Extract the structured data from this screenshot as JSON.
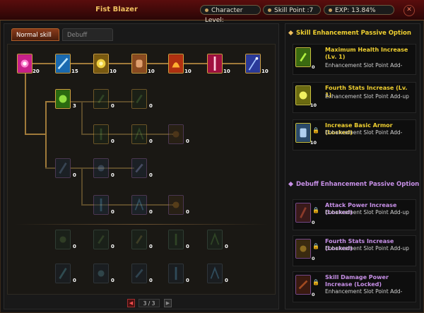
{
  "window": {
    "title": "Fist Blazer",
    "character_level_label": "Character Level:",
    "skill_point_label": "Skill Point :7",
    "exp_label": "EXP:  13.84%",
    "close_symbol": "✕"
  },
  "tabs": [
    {
      "label": "Normal skill enh",
      "active": true
    },
    {
      "label": "Debuff Explosio",
      "active": false
    }
  ],
  "tree": {
    "top_row_levels": [
      "20",
      "15",
      "10",
      "10",
      "10",
      "10",
      "10"
    ],
    "branch1_levels": [
      "3",
      "0",
      "0"
    ],
    "branch1b_levels": [
      "0",
      "0",
      "0"
    ],
    "branch2_levels": [
      "0",
      "0",
      "0"
    ],
    "branch2b_levels": [
      "0",
      "0",
      "0"
    ],
    "locked_row1_levels": [
      "0",
      "0",
      "0",
      "0",
      "0"
    ],
    "locked_row2_levels": [
      "0",
      "0",
      "0",
      "0",
      "0"
    ]
  },
  "pager": {
    "prev": "◀",
    "text": "3 / 3",
    "next": "▶"
  },
  "skill_enhancement": {
    "header": "Skill Enhancement Passive Option",
    "options": [
      {
        "title": "Maximum Health Increase (Lv. 1)",
        "desc": "Enhancement Slot Point Add-",
        "level": "0",
        "locked": false
      },
      {
        "title": "Fourth Stats Increase (Lv. 1)",
        "desc": "Enhancement Slot Point Add-up",
        "level": "10",
        "locked": false
      },
      {
        "title": "Increase Basic Armor (Locked)",
        "desc": "Enhancement Slot Point Add-",
        "level": "10",
        "locked": true
      }
    ]
  },
  "debuff_enhancement": {
    "header": "Debuff Enhancement Passive Option",
    "options": [
      {
        "title": "Attack Power Increase (Locked)",
        "desc": "Enhancement Slot Point Add-up",
        "level": "0",
        "locked": true
      },
      {
        "title": "Fourth Stats Increase (Locked)",
        "desc": "Enhancement Slot Point Add-up",
        "level": "0",
        "locked": true
      },
      {
        "title": "Skill Damage Power Increase (Locked)",
        "desc": "Enhancement Slot Point Add-",
        "level": "0",
        "locked": true
      }
    ]
  },
  "colors": {
    "accent_gold": "#f0c060",
    "skill_title": "#f0d030",
    "debuff_title": "#c890e8"
  }
}
